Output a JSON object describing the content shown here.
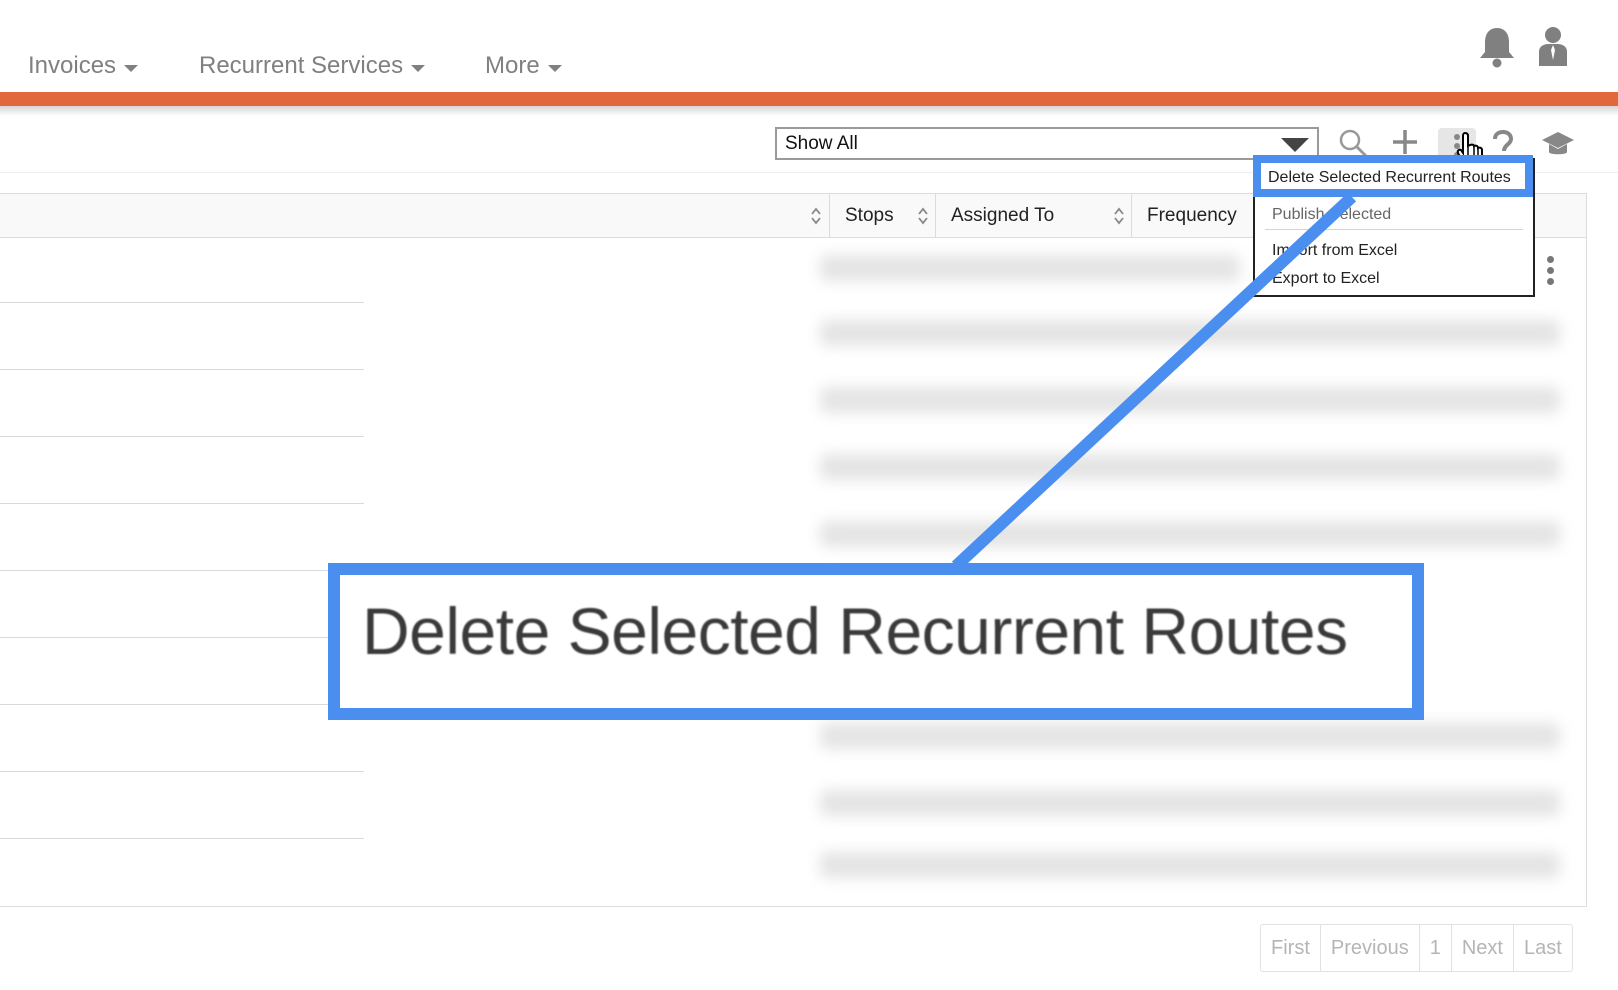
{
  "nav": {
    "items": [
      {
        "label": "Invoices"
      },
      {
        "label": "Recurrent Services"
      },
      {
        "label": "More"
      }
    ],
    "accent_color": "#e0683b"
  },
  "toolbar": {
    "filter_value": "Show All",
    "icons": [
      "search-icon",
      "add-icon",
      "more-options-icon",
      "help-icon",
      "graduation-cap-icon"
    ]
  },
  "table": {
    "columns": [
      {
        "label": "Stops"
      },
      {
        "label": "Assigned To"
      },
      {
        "label": "Frequency"
      }
    ]
  },
  "menu": {
    "items": [
      {
        "label": "Delete Selected Recurrent Routes"
      },
      {
        "label": "Publish Selected"
      },
      {
        "label": "Import from Excel"
      },
      {
        "label": "Export to Excel"
      }
    ]
  },
  "callout": {
    "text": "Delete Selected Recurrent Routes",
    "color": "#4a8fef"
  },
  "pagination": {
    "first": "First",
    "previous": "Previous",
    "page": "1",
    "next": "Next",
    "last": "Last"
  }
}
